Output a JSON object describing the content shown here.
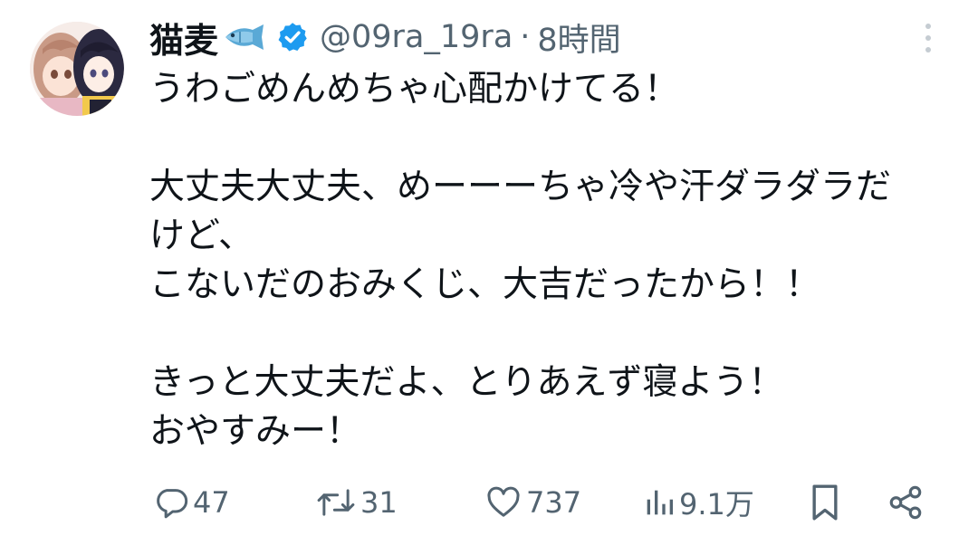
{
  "tweet": {
    "display_name": "猫麦",
    "handle": "@09ra_19ra",
    "separator": "·",
    "time": "8時間",
    "icons": {
      "name_emoji": "fish-icon",
      "verified": "verified-badge-icon",
      "more": "more-options-icon"
    },
    "verified_color": "#1d9bf0",
    "lines": [
      "うわごめんめちゃ心配かけてる！",
      "",
      "大丈夫大丈夫、めーーーちゃ冷や汗ダラダラだ",
      "けど、",
      "こないだのおみくじ、大吉だったから！！",
      "",
      "きっと大丈夫だよ、とりあえず寝よう！",
      "おやすみー！"
    ],
    "actions": {
      "reply": {
        "icon": "reply-icon",
        "count": "47"
      },
      "retweet": {
        "icon": "retweet-icon",
        "count": "31"
      },
      "like": {
        "icon": "heart-icon",
        "count": "737"
      },
      "views": {
        "icon": "views-icon",
        "count": "9.1万"
      },
      "bookmark": {
        "icon": "bookmark-icon"
      },
      "share": {
        "icon": "share-icon"
      }
    }
  }
}
